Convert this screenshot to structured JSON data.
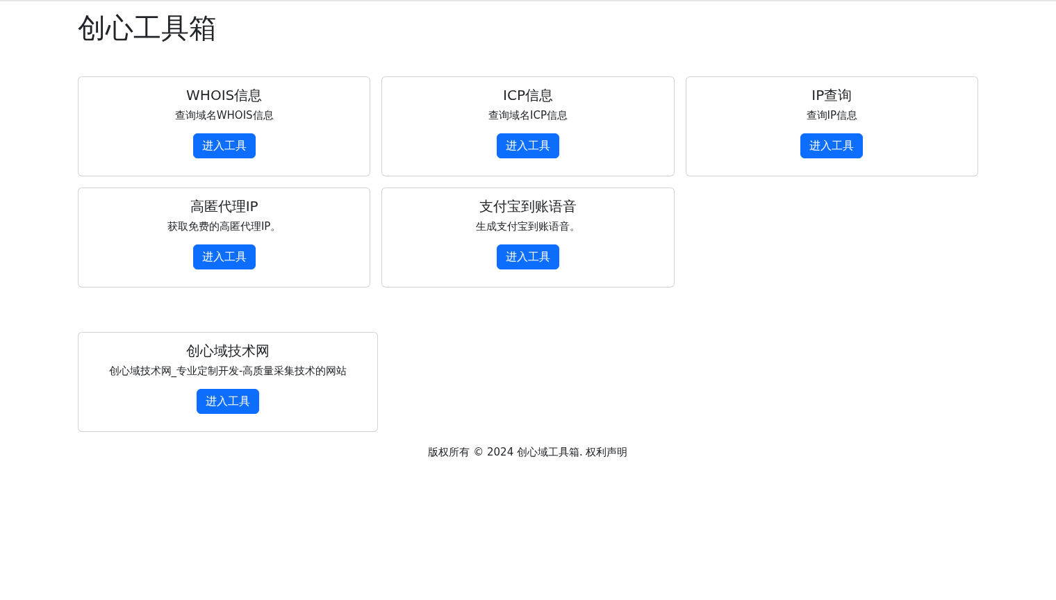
{
  "title": "创心工具箱",
  "tools": [
    {
      "title": "WHOIS信息",
      "description": "查询域名WHOIS信息",
      "button": "进入工具"
    },
    {
      "title": "ICP信息",
      "description": "查询域名ICP信息",
      "button": "进入工具"
    },
    {
      "title": "IP查询",
      "description": "查询IP信息",
      "button": "进入工具"
    },
    {
      "title": "高匿代理IP",
      "description": "获取免费的高匿代理IP。",
      "button": "进入工具"
    },
    {
      "title": "支付宝到账语音",
      "description": "生成支付宝到账语音。",
      "button": "进入工具"
    }
  ],
  "sites": [
    {
      "title": "创心域技术网",
      "description": "创心域技术网_专业定制开发-高质量采集技术的网站",
      "button": "进入工具"
    }
  ],
  "footer": "版权所有 © 2024 创心域工具箱. 权利声明"
}
